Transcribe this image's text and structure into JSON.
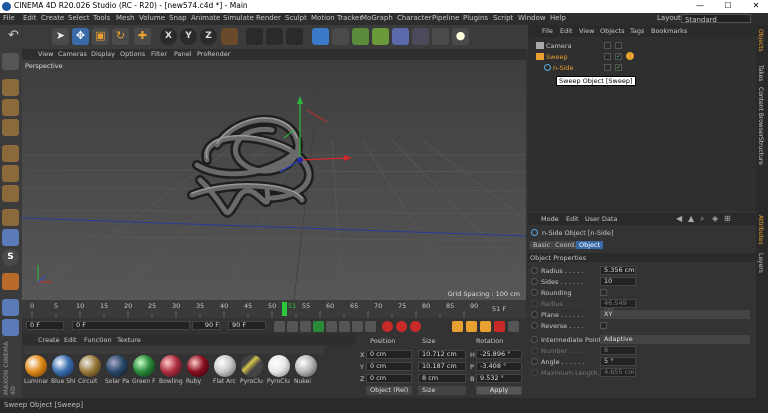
{
  "window": {
    "title": "CINEMA 4D R20.026 Studio (RC - R20) - [new574.c4d *] - Main"
  },
  "menus": [
    "File",
    "Edit",
    "Create",
    "Select",
    "Tools",
    "Mesh",
    "Volume",
    "Snap",
    "Animate",
    "Simulate",
    "Render",
    "Sculpt",
    "Motion Tracker",
    "MoGraph",
    "Character",
    "Pipeline",
    "Plugins",
    "Script",
    "Window",
    "Help"
  ],
  "layout": {
    "label": "Layout:",
    "value": "Standard"
  },
  "viewport": {
    "menus": [
      "View",
      "Cameras",
      "Display",
      "Options",
      "Filter",
      "Panel",
      "ProRender"
    ],
    "label": "Perspective",
    "grid_spacing": "Grid Spacing : 100 cm"
  },
  "timeline": {
    "ticks": [
      "0",
      "5",
      "10",
      "15",
      "20",
      "25",
      "30",
      "35",
      "40",
      "45",
      "50",
      "51",
      "55",
      "60",
      "65",
      "70",
      "75",
      "80",
      "85",
      "90"
    ],
    "current_frame": "51 F"
  },
  "transport": {
    "start": "0 F",
    "current": "0 F",
    "end_a": "90 F",
    "end_b": "90 F"
  },
  "materials": {
    "menus": [
      "Create",
      "Edit",
      "Function",
      "Texture"
    ],
    "items": [
      {
        "name": "Luminan",
        "color": "#e08a1a"
      },
      {
        "name": "Blue Shi",
        "color": "#3a6fb0"
      },
      {
        "name": "Circuit",
        "color": "#9a7a3a"
      },
      {
        "name": "Solar Pa",
        "color": "#2a4a6a"
      },
      {
        "name": "Green F",
        "color": "#2a8a3a"
      },
      {
        "name": "Bowling",
        "color": "#b03040"
      },
      {
        "name": "Ruby",
        "color": "#8a1020"
      },
      {
        "name": "Flat Arc",
        "color": "#c8c8c8"
      },
      {
        "name": "PyroClu",
        "color": "#d8c848"
      },
      {
        "name": "PyroClu",
        "color": "#e8e8e8"
      },
      {
        "name": "Nukei",
        "color": "#b8b8b8"
      }
    ]
  },
  "coords": {
    "headers": [
      "Position",
      "Size",
      "Rotation"
    ],
    "rows": [
      {
        "axis": "X",
        "pos": "0 cm",
        "size": "10.712 cm",
        "rlabel": "H",
        "rot": "-25.896 °"
      },
      {
        "axis": "Y",
        "pos": "0 cm",
        "size": "10.187 cm",
        "rlabel": "P",
        "rot": "-3.408 °"
      },
      {
        "axis": "Z",
        "pos": "0 cm",
        "size": "8 cm",
        "rlabel": "B",
        "rot": "9.532 °"
      }
    ],
    "mode": "Object (Rel)",
    "size_mode": "Size",
    "apply": "Apply"
  },
  "objects": {
    "menus": [
      "File",
      "Edit",
      "View",
      "Objects",
      "Tags",
      "Bookmarks"
    ],
    "items": [
      {
        "name": "Camera",
        "color": "#c8c8c8"
      },
      {
        "name": "Sweep",
        "color": "#e8a030"
      },
      {
        "name": "n-Side",
        "color": "#e8a030"
      }
    ],
    "tooltip": "Sweep Object [Sweep]"
  },
  "attributes": {
    "menus": [
      "Mode",
      "Edit",
      "User Data"
    ],
    "object_title": "n-Side Object [n-Side]",
    "tabs": [
      "Basic",
      "Coord.",
      "Object"
    ],
    "section": "Object Properties",
    "props": [
      {
        "label": "Radius . . . . .",
        "value": "5.356 cm"
      },
      {
        "label": "Sides . . . . . .",
        "value": "10"
      },
      {
        "label": "Rounding",
        "value": ""
      },
      {
        "label": "Radius . . . . .",
        "value": "46.549 cm"
      },
      {
        "label": "Plane . . . . . .",
        "value": "XY"
      },
      {
        "label": "Reverse . . . .",
        "value": ""
      }
    ],
    "interp_label": "Intermediate Points",
    "interp_value": "Adaptive",
    "props2": [
      {
        "label": "Number . . . . .",
        "value": "8"
      },
      {
        "label": "Angle . . . . . .",
        "value": "5 °"
      },
      {
        "label": "Maximum Length.",
        "value": "4.655 cm"
      }
    ]
  },
  "right_tabs": [
    "Objects",
    "Takes",
    "Content Browser",
    "Structure",
    "Attributes",
    "Layers"
  ],
  "status": {
    "text": "Sweep Object [Sweep]"
  }
}
